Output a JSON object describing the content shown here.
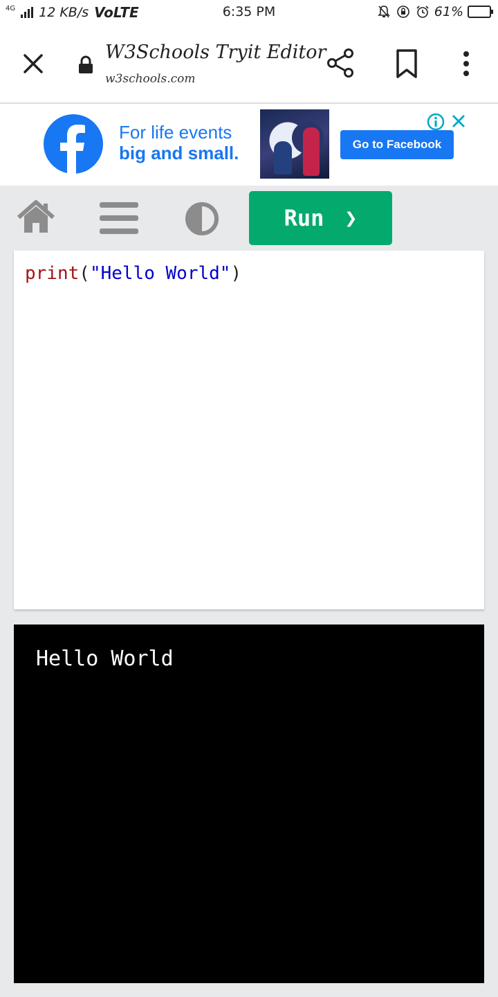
{
  "status_bar": {
    "network_tag": "4G",
    "speed": "12 KB/s",
    "volte": "VoLTE",
    "time": "6:35 PM",
    "battery": "61%",
    "battery_level": 0.61,
    "icons": [
      "mute-bell-icon",
      "rotation-lock-icon",
      "alarm-clock-icon",
      "battery-icon"
    ]
  },
  "browser": {
    "title": "W3Schools Tryit Editor",
    "url": "w3schools.com",
    "icons": [
      "close-icon",
      "lock-icon",
      "share-icon",
      "bookmark-icon",
      "more-vert-icon"
    ]
  },
  "ad": {
    "line1": "For life events",
    "line2": "big and small.",
    "cta": "Go to Facebook",
    "brand_color": "#1877f2",
    "icons": [
      "facebook-logo-icon",
      "ad-info-icon",
      "ad-close-icon"
    ]
  },
  "editor_nav": {
    "run_label": "Run",
    "run_chevron": "❯",
    "run_color": "#04aa6d",
    "icons": [
      "home-icon",
      "menu-icon",
      "contrast-icon"
    ]
  },
  "code": {
    "fn": "print",
    "open": "(",
    "str": "\"Hello World\"",
    "close": ")"
  },
  "output": {
    "text": "Hello World"
  }
}
